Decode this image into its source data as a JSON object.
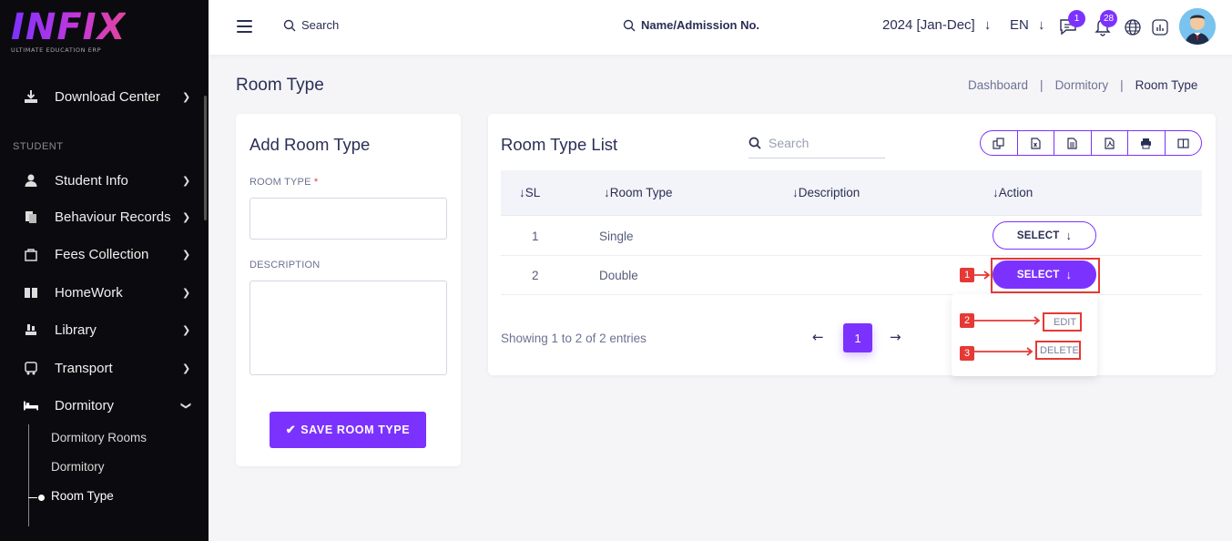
{
  "brand": {
    "name": "INFIX",
    "tagline": "ULTIMATE EDUCATION ERP"
  },
  "sidebar": {
    "top_item": {
      "label": "Download Center",
      "icon": "download-icon"
    },
    "section_label": "STUDENT",
    "items": [
      {
        "label": "Student Info",
        "icon": "student-icon"
      },
      {
        "label": "Behaviour Records",
        "icon": "records-icon"
      },
      {
        "label": "Fees Collection",
        "icon": "fees-icon"
      },
      {
        "label": "HomeWork",
        "icon": "book-icon"
      },
      {
        "label": "Library",
        "icon": "library-icon"
      },
      {
        "label": "Transport",
        "icon": "bus-icon"
      },
      {
        "label": "Dormitory",
        "icon": "bed-icon"
      }
    ],
    "sub_items": [
      {
        "label": "Dormitory Rooms"
      },
      {
        "label": "Dormitory"
      },
      {
        "label": "Room Type"
      }
    ]
  },
  "header": {
    "search_label": "Search",
    "admission_search_label": "Name/Admission No.",
    "academic_year": "2024 [Jan-Dec]",
    "language": "EN",
    "messages_count": "1",
    "notifications_count": "28"
  },
  "page": {
    "title": "Room Type",
    "breadcrumb": [
      "Dashboard",
      "Dormitory",
      "Room Type"
    ]
  },
  "form": {
    "title": "Add Room Type",
    "room_type_label": "ROOM TYPE",
    "required_mark": "*",
    "description_label": "DESCRIPTION",
    "save_label": "SAVE ROOM TYPE"
  },
  "list": {
    "title": "Room Type List",
    "search_placeholder": "Search",
    "export_buttons": [
      "copy-icon",
      "excel-icon",
      "csv-icon",
      "pdf-icon",
      "print-icon",
      "columns-icon"
    ],
    "columns": [
      "SL",
      "Room Type",
      "Description",
      "Action"
    ],
    "rows": [
      {
        "sl": "1",
        "room_type": "Single",
        "description": "",
        "action": "SELECT"
      },
      {
        "sl": "2",
        "room_type": "Double",
        "description": "",
        "action": "SELECT"
      }
    ],
    "showing_text": "Showing 1 to 2 of 2 entries",
    "current_page": "1",
    "dropdown": {
      "edit": "EDIT",
      "delete": "DELETE"
    }
  },
  "annotations": [
    "1",
    "2",
    "3"
  ],
  "colors": {
    "accent": "#7c32ff",
    "sidebar_bg": "#0b0b0f",
    "annotation": "#e53935"
  }
}
